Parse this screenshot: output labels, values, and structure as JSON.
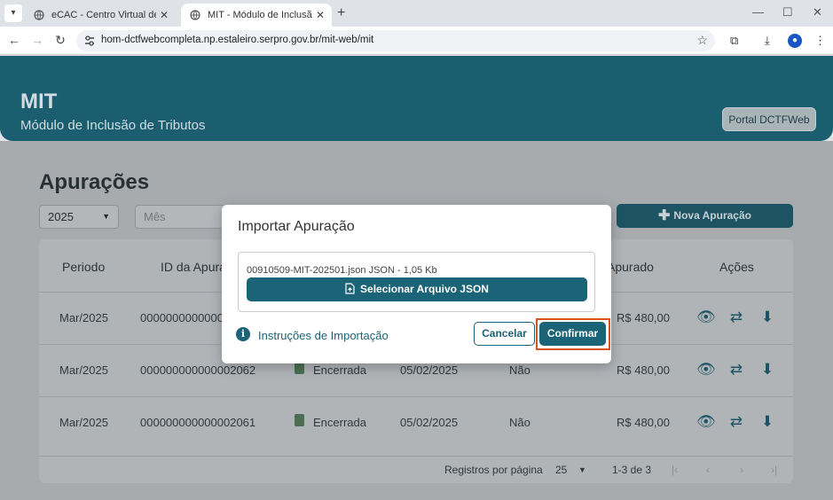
{
  "browser": {
    "tabs": [
      {
        "title": "eCAC - Centro Virtual de Atendimento",
        "active": false
      },
      {
        "title": "MIT - Módulo de Inclusão de Tributos",
        "active": true
      }
    ],
    "url": "hom-dctfwebcompleta.np.estaleiro.serpro.gov.br/mit-web/mit"
  },
  "header": {
    "title": "MIT",
    "subtitle": "Módulo de Inclusão de Tributos",
    "portal_button": "Portal DCTFWeb"
  },
  "page": {
    "title": "Apurações",
    "year": "2025",
    "month_placeholder": "Mês",
    "new_button": "Nova Apuração"
  },
  "table": {
    "headers": [
      "Periodo",
      "ID da Apuração",
      "Apurado",
      "Ações"
    ],
    "rows": [
      {
        "periodo": "Mar/2025",
        "id": "0000000000000002063",
        "status": "",
        "data": "",
        "flag": "",
        "valor": "R$ 480,00"
      },
      {
        "periodo": "Mar/2025",
        "id": "000000000000002062",
        "status": "Encerrada",
        "data": "05/02/2025",
        "flag": "Não",
        "valor": "R$ 480,00"
      },
      {
        "periodo": "Mar/2025",
        "id": "000000000000002061",
        "status": "Encerrada",
        "data": "05/02/2025",
        "flag": "Não",
        "valor": "R$ 480,00"
      }
    ],
    "pager": {
      "label": "Registros por página",
      "per_page": "25",
      "range": "1-3 de 3"
    }
  },
  "modal": {
    "title": "Importar Apuração",
    "file_name": "00910509-MIT-202501.json JSON - 1,05 Kb",
    "select_button": "Selecionar Arquivo JSON",
    "info_link": "Instruções de Importação",
    "cancel": "Cancelar",
    "confirm": "Confirmar"
  },
  "colors": {
    "primary": "#1b6377",
    "header": "#1b5e70",
    "highlight": "#d9531e"
  }
}
